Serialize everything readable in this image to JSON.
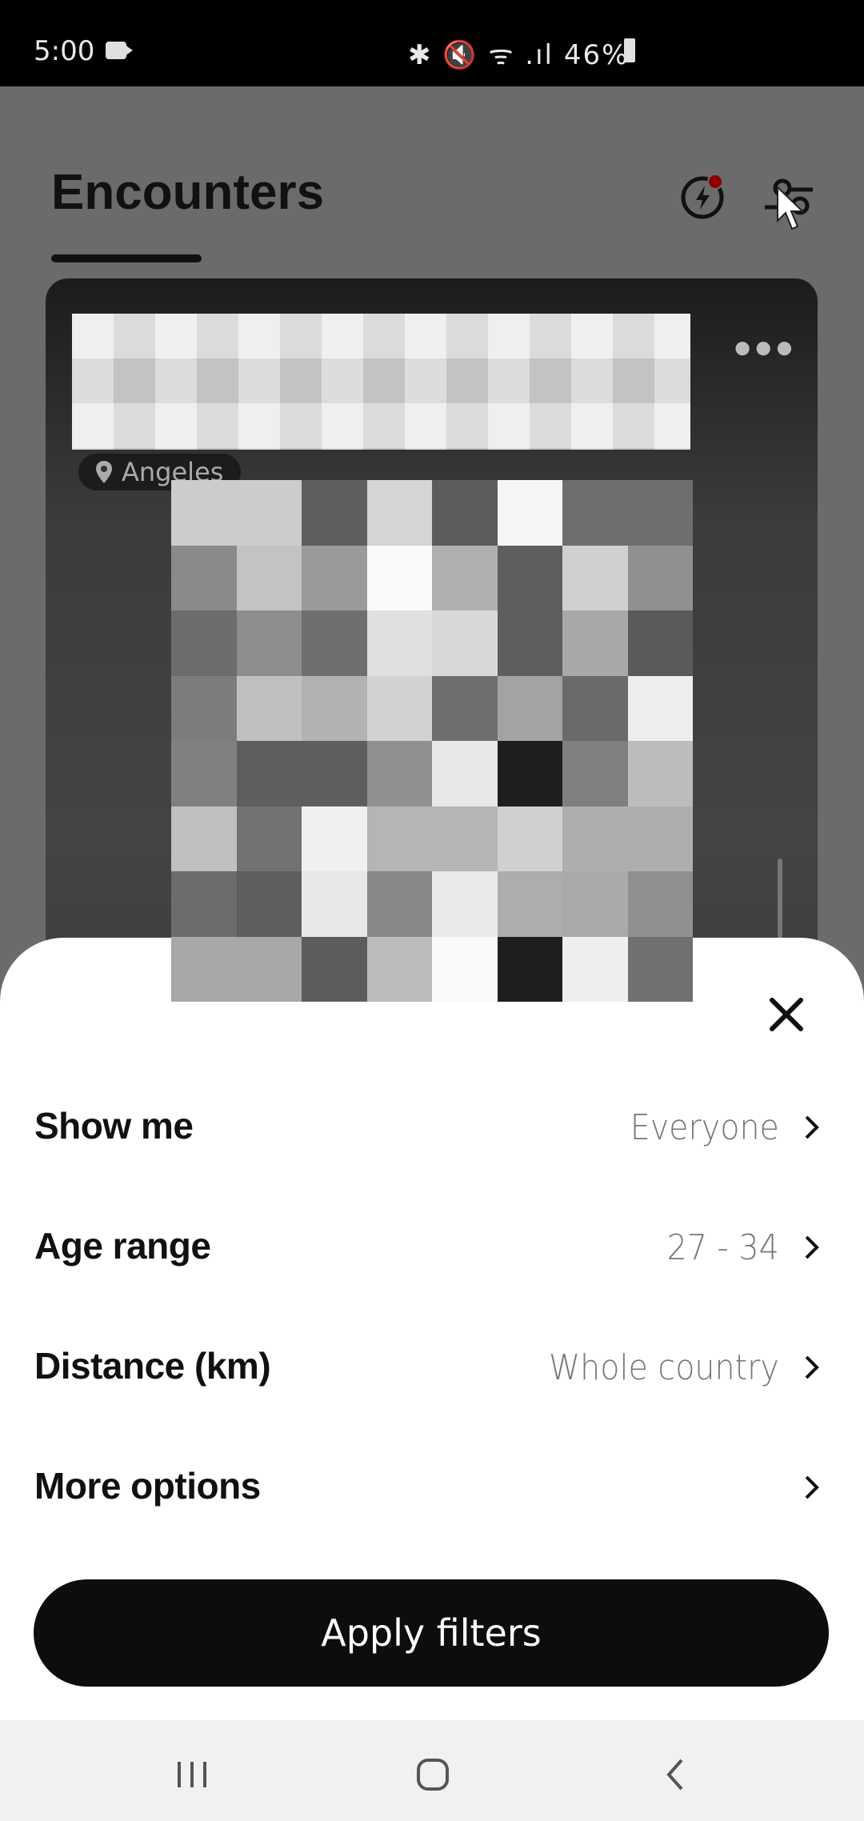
{
  "status_bar": {
    "time": "5:00",
    "icons": "✱ 🔇 ᯤ .ıl",
    "battery": "46%"
  },
  "header": {
    "title": "Encounters",
    "boost_icon": "lightning-circle-icon",
    "filter_icon": "filter-sliders-icon",
    "notification_color": "#8b0000"
  },
  "card": {
    "location": "Angeles",
    "menu_icon": "more-dots-icon"
  },
  "sheet": {
    "close_icon": "close-icon",
    "rows": [
      {
        "label": "Show me",
        "value": "Everyone"
      },
      {
        "label": "Age range",
        "value": "27 - 34"
      },
      {
        "label": "Distance (km)",
        "value": "Whole country"
      },
      {
        "label": "More options",
        "value": ""
      }
    ],
    "apply_label": "Apply filters"
  },
  "nav": {
    "recent": "recents-icon",
    "home": "home-icon",
    "back": "back-icon"
  }
}
